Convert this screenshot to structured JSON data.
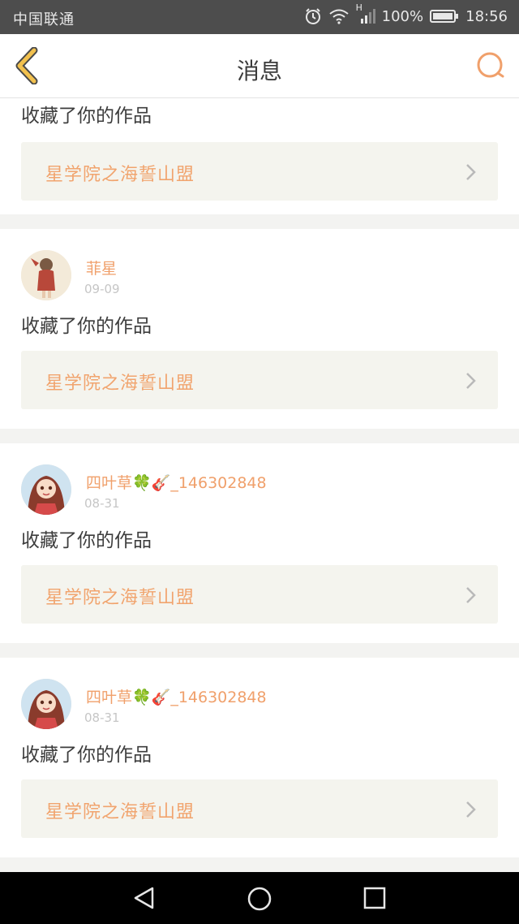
{
  "status_bar": {
    "carrier": "中国联通",
    "network_type": "H",
    "battery_percent": "100%",
    "time": "18:56"
  },
  "nav": {
    "title": "消息"
  },
  "first_item": {
    "action": "收藏了你的作品",
    "work_title": "星学院之海誓山盟"
  },
  "messages": [
    {
      "username": "菲星",
      "date": "09-09",
      "action": "收藏了你的作品",
      "work_title": "星学院之海誓山盟"
    },
    {
      "username": "四叶草🍀🎸_146302848",
      "date": "08-31",
      "action": "收藏了你的作品",
      "work_title": "星学院之海誓山盟"
    },
    {
      "username": "四叶草🍀🎸_146302848",
      "date": "08-31",
      "action": "收藏了你的作品",
      "work_title": "星学院之海誓山盟"
    }
  ],
  "colors": {
    "accent": "#f0a06b",
    "back_arrow": "#f2c14e",
    "status_bar": "#4d4d4d"
  }
}
